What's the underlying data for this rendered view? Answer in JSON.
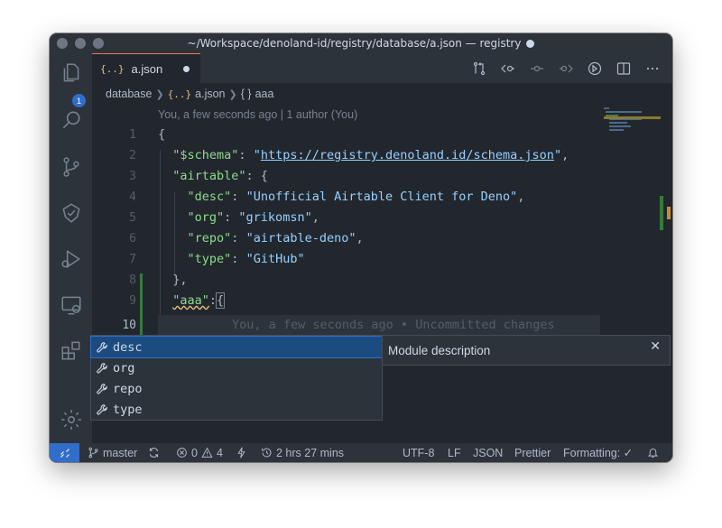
{
  "window": {
    "title": "~/Workspace/denoland-id/registry/database/a.json — registry"
  },
  "activity": {
    "explorer_badge": "1"
  },
  "tabs": [
    {
      "badge": "{..}",
      "label": "a.json"
    }
  ],
  "breadcrumb": {
    "folder": "database",
    "file_badge": "{..}",
    "file": "a.json",
    "symbol_icon": "{ }",
    "symbol": "aaa"
  },
  "editor": {
    "blame_header": "You, a few seconds ago | 1 author (You)",
    "line_numbers": [
      "1",
      "2",
      "3",
      "4",
      "5",
      "6",
      "7",
      "8",
      "9",
      "10"
    ],
    "lines": {
      "l1": "{",
      "l2_key": "\"$schema\"",
      "l2_colon": ": ",
      "l2_q1": "\"",
      "l2_url": "https://registry.denoland.id/schema.json",
      "l2_q2": "\"",
      "l2_end": ",",
      "l3_key": "\"airtable\"",
      "l3_rest": ": {",
      "l4_key": "\"desc\"",
      "l4_colon": ": ",
      "l4_val": "\"Unofficial Airtable Client for Deno\"",
      "l4_end": ",",
      "l5_key": "\"org\"",
      "l5_colon": ": ",
      "l5_val": "\"grikomsn\"",
      "l5_end": ",",
      "l6_key": "\"repo\"",
      "l6_colon": ": ",
      "l6_val": "\"airtable-deno\"",
      "l6_end": ",",
      "l7_key": "\"type\"",
      "l7_colon": ": ",
      "l7_val": "\"GitHub\"",
      "l8": "},",
      "l9_key": "\"aaa\"",
      "l9_colon": ":",
      "l9_brace": "{"
    },
    "inline_blame": "You, a few seconds ago • Uncommitted changes"
  },
  "suggest": {
    "items": [
      "desc",
      "org",
      "repo",
      "type"
    ],
    "selected_index": 0,
    "detail": "Module description"
  },
  "status": {
    "branch": "master",
    "errors": "0",
    "warnings": "4",
    "time": "2 hrs 27 mins",
    "encoding": "UTF-8",
    "eol": "LF",
    "language": "JSON",
    "formatter": "Prettier",
    "formatting": "Formatting: ✓"
  },
  "colors": {
    "accent": "#316dca",
    "modified": "#347d39",
    "string": "#96d0ff",
    "key_green": "#8ddb8c",
    "json_badge": "#e5c07b"
  }
}
